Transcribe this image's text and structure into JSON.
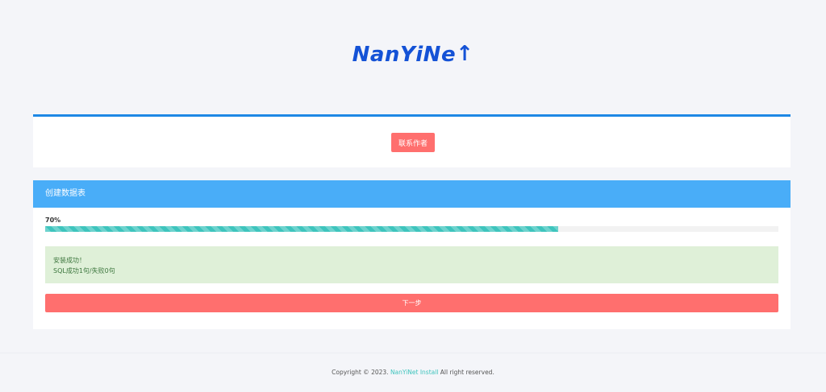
{
  "brand": {
    "logo_text": "NanYiNe",
    "logo_tail": "t",
    "color": "#1452d6"
  },
  "top_card": {
    "contact_label": "联系作者"
  },
  "main_card": {
    "title": "创建数据表",
    "progress_label": "70%",
    "progress_value": 0.7,
    "alert_line1": "安装成功！",
    "alert_line2": "SQL成功1句/失败0句",
    "next_label": "下一步"
  },
  "footer": {
    "prefix": "Copyright © 2023. ",
    "link": "NanYiNet Install",
    "suffix": " All right reserved."
  },
  "colors": {
    "accent_blue": "#1e88e5",
    "header_blue": "#49adf8",
    "button_red": "#ff6f6e",
    "progress_teal": "#3ec4bd",
    "success_bg": "#dff0d8"
  }
}
